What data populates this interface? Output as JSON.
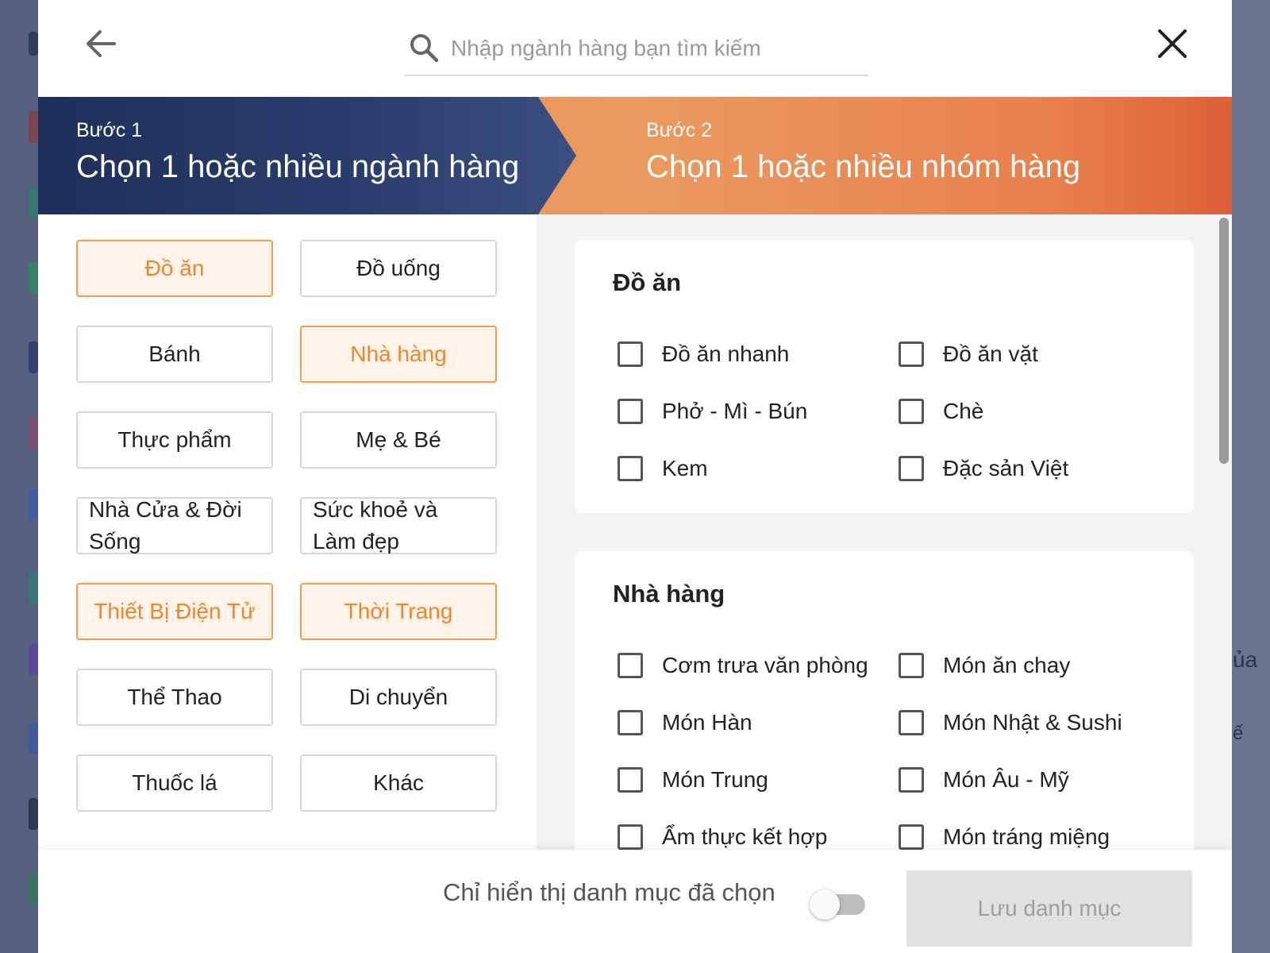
{
  "header": {
    "search_placeholder": "Nhập ngành hàng bạn tìm kiếm"
  },
  "steps": {
    "step1_label": "Bước 1",
    "step1_title": "Chọn 1 hoặc nhiều ngành hàng",
    "step2_label": "Bước 2",
    "step2_title": "Chọn 1 hoặc nhiều nhóm hàng"
  },
  "categories": [
    {
      "label": "Đồ ăn",
      "selected": true
    },
    {
      "label": "Đồ uống",
      "selected": false
    },
    {
      "label": "Bánh",
      "selected": false
    },
    {
      "label": "Nhà hàng",
      "selected": true
    },
    {
      "label": "Thực phẩm",
      "selected": false
    },
    {
      "label": "Mẹ & Bé",
      "selected": false
    },
    {
      "label": "Nhà Cửa & Đời Sống",
      "selected": false
    },
    {
      "label": "Sức khoẻ và Làm đẹp",
      "selected": false
    },
    {
      "label": "Thiết Bị Điện Tử",
      "selected": true
    },
    {
      "label": "Thời Trang",
      "selected": true
    },
    {
      "label": "Thể Thao",
      "selected": false
    },
    {
      "label": "Di chuyển",
      "selected": false
    },
    {
      "label": "Thuốc lá",
      "selected": false
    },
    {
      "label": "Khác",
      "selected": false
    }
  ],
  "groups": [
    {
      "title": "Đồ ăn",
      "options": [
        {
          "label": "Đồ ăn nhanh",
          "checked": false
        },
        {
          "label": "Đồ ăn vặt",
          "checked": false
        },
        {
          "label": "Phở - Mì - Bún",
          "checked": false
        },
        {
          "label": "Chè",
          "checked": false
        },
        {
          "label": "Kem",
          "checked": false
        },
        {
          "label": "Đặc sản Việt",
          "checked": false
        }
      ]
    },
    {
      "title": "Nhà hàng",
      "options": [
        {
          "label": "Cơm trưa văn phòng",
          "checked": false
        },
        {
          "label": "Món ăn chay",
          "checked": false
        },
        {
          "label": "Món Hàn",
          "checked": false
        },
        {
          "label": "Món Nhật & Sushi",
          "checked": false
        },
        {
          "label": "Món Trung",
          "checked": false
        },
        {
          "label": "Món Âu - Mỹ",
          "checked": false
        },
        {
          "label": "Ẩm thực kết hợp",
          "checked": false
        },
        {
          "label": "Món tráng miệng",
          "checked": false
        }
      ]
    }
  ],
  "footer": {
    "toggle_label": "Chỉ hiển thị danh mục đã chọn",
    "toggle_on": false,
    "save_label": "Lưu danh mục"
  },
  "background": {
    "partial_text_1": "ủa",
    "partial_text_2": "ế"
  },
  "colors": {
    "accent_orange": "#f0862b",
    "selected_bg": "#fff3ea",
    "step1_navy": "#1e2f5b",
    "step2_orange": "#e98e4f"
  }
}
